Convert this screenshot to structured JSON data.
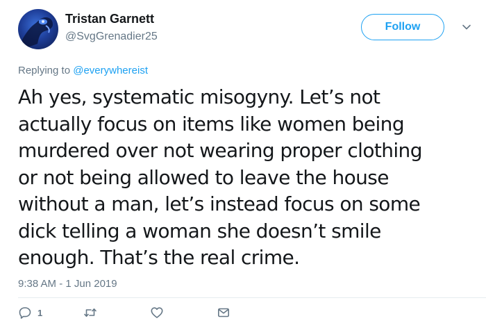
{
  "author": {
    "name": "Tristan Garnett",
    "handle": "@SvgGrenadier25"
  },
  "follow_label": "Follow",
  "reply_context": {
    "prefix": "Replying to",
    "mention": "@everywhereist"
  },
  "tweet_lines": [
    "Ah yes, systematic misogyny. Let’s not",
    "actually focus on items like women being",
    "murdered over not wearing proper clothing",
    "or not being allowed to leave the house",
    "without a man, let’s instead focus on some",
    "dick telling a woman she doesn’t smile",
    "enough. That’s the real crime."
  ],
  "timestamp": "9:38 AM - 1 Jun 2019",
  "actions": {
    "reply_count": "1",
    "icons": [
      "reply-icon",
      "retweet-icon",
      "like-icon",
      "direct-message-icon"
    ]
  },
  "colors": {
    "accent": "#1da1f2",
    "secondary_text": "#657786",
    "primary_text": "#14171a"
  }
}
